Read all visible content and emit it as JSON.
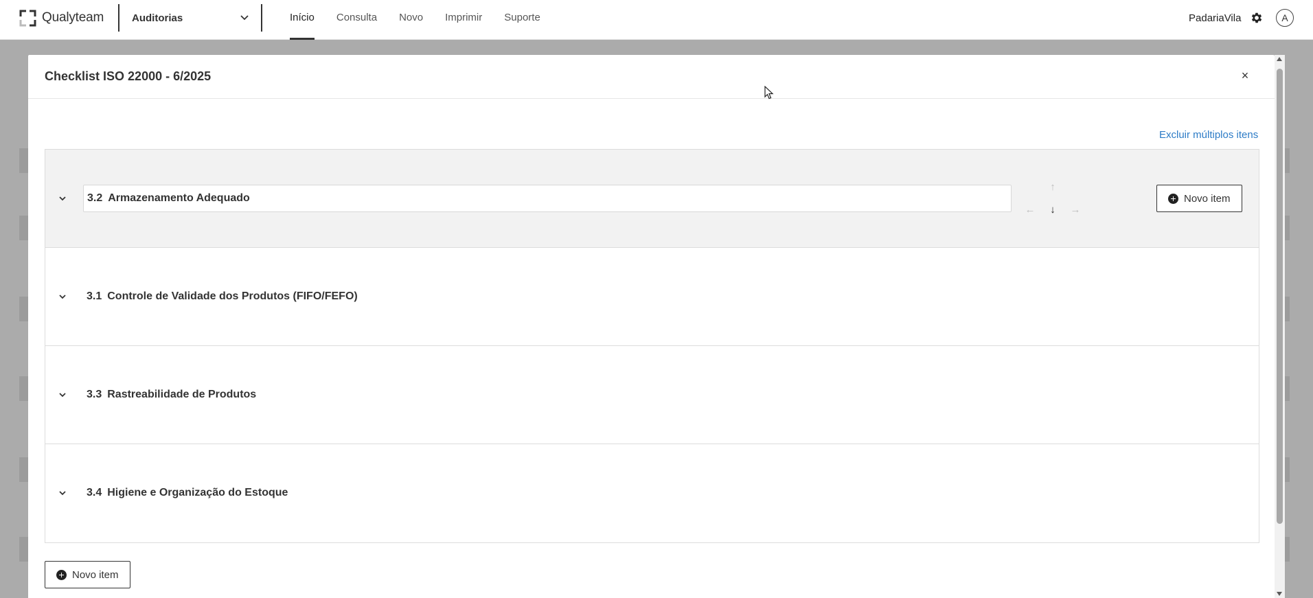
{
  "app": {
    "logo_text": "Qualyteam",
    "module": "Auditorias"
  },
  "nav": [
    {
      "label": "Início",
      "active": true
    },
    {
      "label": "Consulta",
      "active": false
    },
    {
      "label": "Novo",
      "active": false
    },
    {
      "label": "Imprimir",
      "active": false
    },
    {
      "label": "Suporte",
      "active": false
    }
  ],
  "user": {
    "company": "PadariaVila",
    "avatar_initial": "A"
  },
  "modal": {
    "title": "Checklist ISO 22000 - 6/2025",
    "close_glyph": "×",
    "bulk_delete_link": "Excluir múltiplos itens",
    "sections": [
      {
        "number": "3.2",
        "title": "Armazenamento Adequado",
        "editing": true
      },
      {
        "number": "3.1",
        "title": "Controle de Validade dos Produtos (FIFO/FEFO)",
        "editing": false
      },
      {
        "number": "3.3",
        "title": "Rastreabilidade de Produtos",
        "editing": false
      },
      {
        "number": "3.4",
        "title": "Higiene e Organização do Estoque",
        "editing": false
      }
    ],
    "move_arrows": {
      "up": "↑",
      "left": "←",
      "down": "↓",
      "right": "→"
    },
    "section_button_label": "Novo item",
    "footer_button_label": "Novo item"
  },
  "colors": {
    "link": "#2c7bc6",
    "text": "#333333",
    "editing_bg": "#f2f2f2"
  }
}
